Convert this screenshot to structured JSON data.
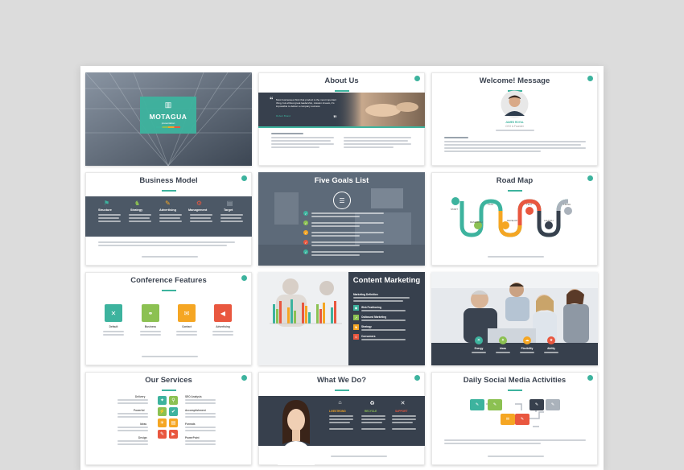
{
  "colors": {
    "teal": "#3db39e",
    "green": "#8cc152",
    "orange": "#f5a623",
    "red": "#e9573f",
    "navy": "#37404d",
    "slate": "#4c5866"
  },
  "slides": {
    "cover": {
      "brand": "MOTAGUA",
      "tagline": "presentation"
    },
    "about": {
      "title": "About Us",
      "quote": "Most businesses think that product is the most important thing, but without great leadership, mission & team, it's impossible to deliver a company success.",
      "quote_author": "Robert Brand"
    },
    "welcome": {
      "title": "Welcome! Message",
      "person_name": "JAMES ROYAL",
      "person_role": "CEO & Founder"
    },
    "business": {
      "title": "Business Model",
      "columns": [
        "Structure",
        "Strategy",
        "Advertising",
        "Management",
        "Target"
      ]
    },
    "goals": {
      "title": "Five Goals List",
      "icon": "list-icon"
    },
    "roadmap": {
      "title": "Road Map",
      "stops": [
        "START",
        "RESEARCH",
        "PLAN",
        "DEVELOP",
        "TEST",
        "LAUNCH",
        "FINISH"
      ]
    },
    "conference": {
      "title": "Conference Features",
      "features": [
        "Default",
        "Business",
        "Contact",
        "Advertising"
      ]
    },
    "content_marketing": {
      "title": "Content Marketing",
      "items": [
        "Marketing Definition",
        "Web Positioning",
        "Outbound Marketing",
        "Strategy",
        "Consumers"
      ]
    },
    "team": {
      "features": [
        "Energy",
        "Ideas",
        "Flexibility",
        "Ability"
      ]
    },
    "services": {
      "title": "Our Services",
      "left": [
        "Delivery",
        "Powerful",
        "Ideas",
        "Design"
      ],
      "right": [
        "SEO Analysis",
        "Accomplishment",
        "Formats",
        "PowerPoint"
      ]
    },
    "whatwedo": {
      "title": "What We Do?",
      "columns": [
        "LIVESTRONG",
        "RECYCLE",
        "SUPPORT"
      ]
    },
    "social": {
      "title": "Daily Social Media Activities"
    }
  }
}
